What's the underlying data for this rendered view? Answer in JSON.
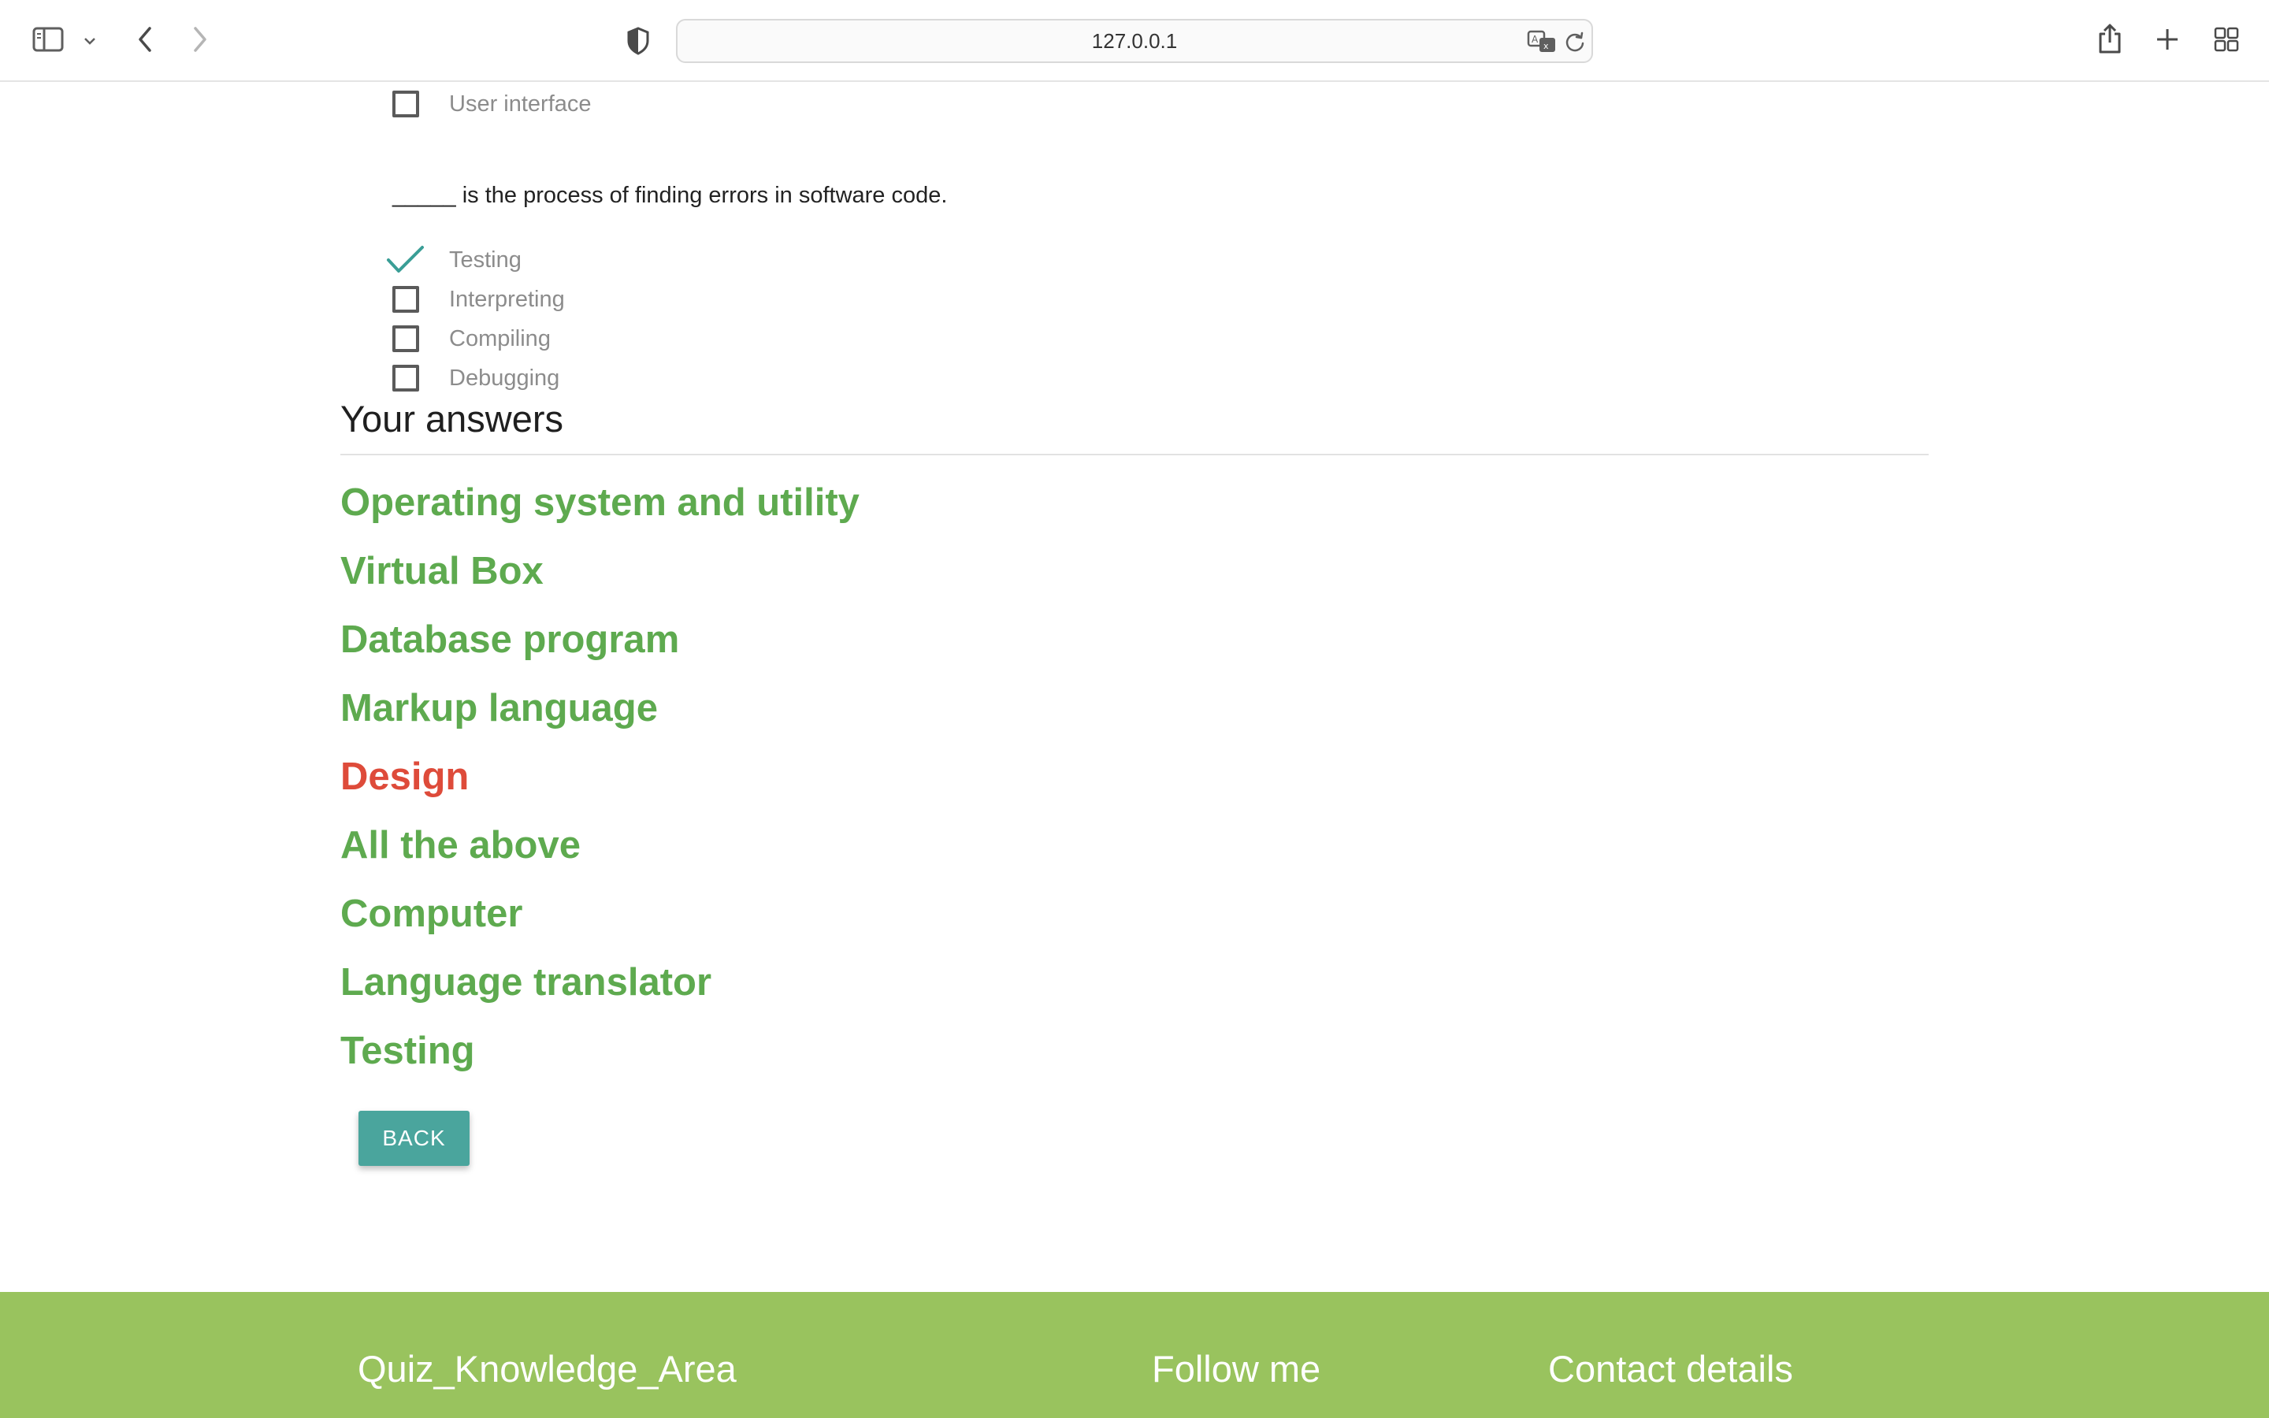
{
  "browser": {
    "url": "127.0.0.1",
    "icons": {
      "sidebar": "sidebar-toggle-icon",
      "sidebar_menu": "chevron-down-icon",
      "back": "back-arrow-icon",
      "forward": "forward-arrow-icon",
      "privacy": "shield-icon",
      "translate": "translate-icon",
      "reload": "reload-icon",
      "share": "share-icon",
      "new_tab": "plus-icon",
      "tab_overview": "tab-grid-icon"
    }
  },
  "prev_question": {
    "options": [
      {
        "label": "User interface",
        "checked": false
      }
    ]
  },
  "question": {
    "text": "_____ is the process of finding errors in software code.",
    "options": [
      {
        "label": "Testing",
        "checked": true
      },
      {
        "label": "Interpreting",
        "checked": false
      },
      {
        "label": "Compiling",
        "checked": false
      },
      {
        "label": "Debugging",
        "checked": false
      }
    ]
  },
  "answers": {
    "heading": "Your answers",
    "items": [
      {
        "text": "Operating system and utility",
        "status": "correct"
      },
      {
        "text": "Virtual Box",
        "status": "correct"
      },
      {
        "text": "Database program",
        "status": "correct"
      },
      {
        "text": "Markup language",
        "status": "correct"
      },
      {
        "text": "Design",
        "status": "wrong"
      },
      {
        "text": "All the above",
        "status": "correct"
      },
      {
        "text": "Computer",
        "status": "correct"
      },
      {
        "text": "Language translator",
        "status": "correct"
      },
      {
        "text": "Testing",
        "status": "correct"
      }
    ],
    "back_label": "BACK"
  },
  "footer": {
    "brand": "Quiz_Knowledge_Area",
    "follow": "Follow me",
    "contact": "Contact details"
  },
  "colors": {
    "correct": "#5eaa4f",
    "wrong": "#de4b3a",
    "accent": "#4aa59d",
    "footer_bg": "#99c35e"
  }
}
